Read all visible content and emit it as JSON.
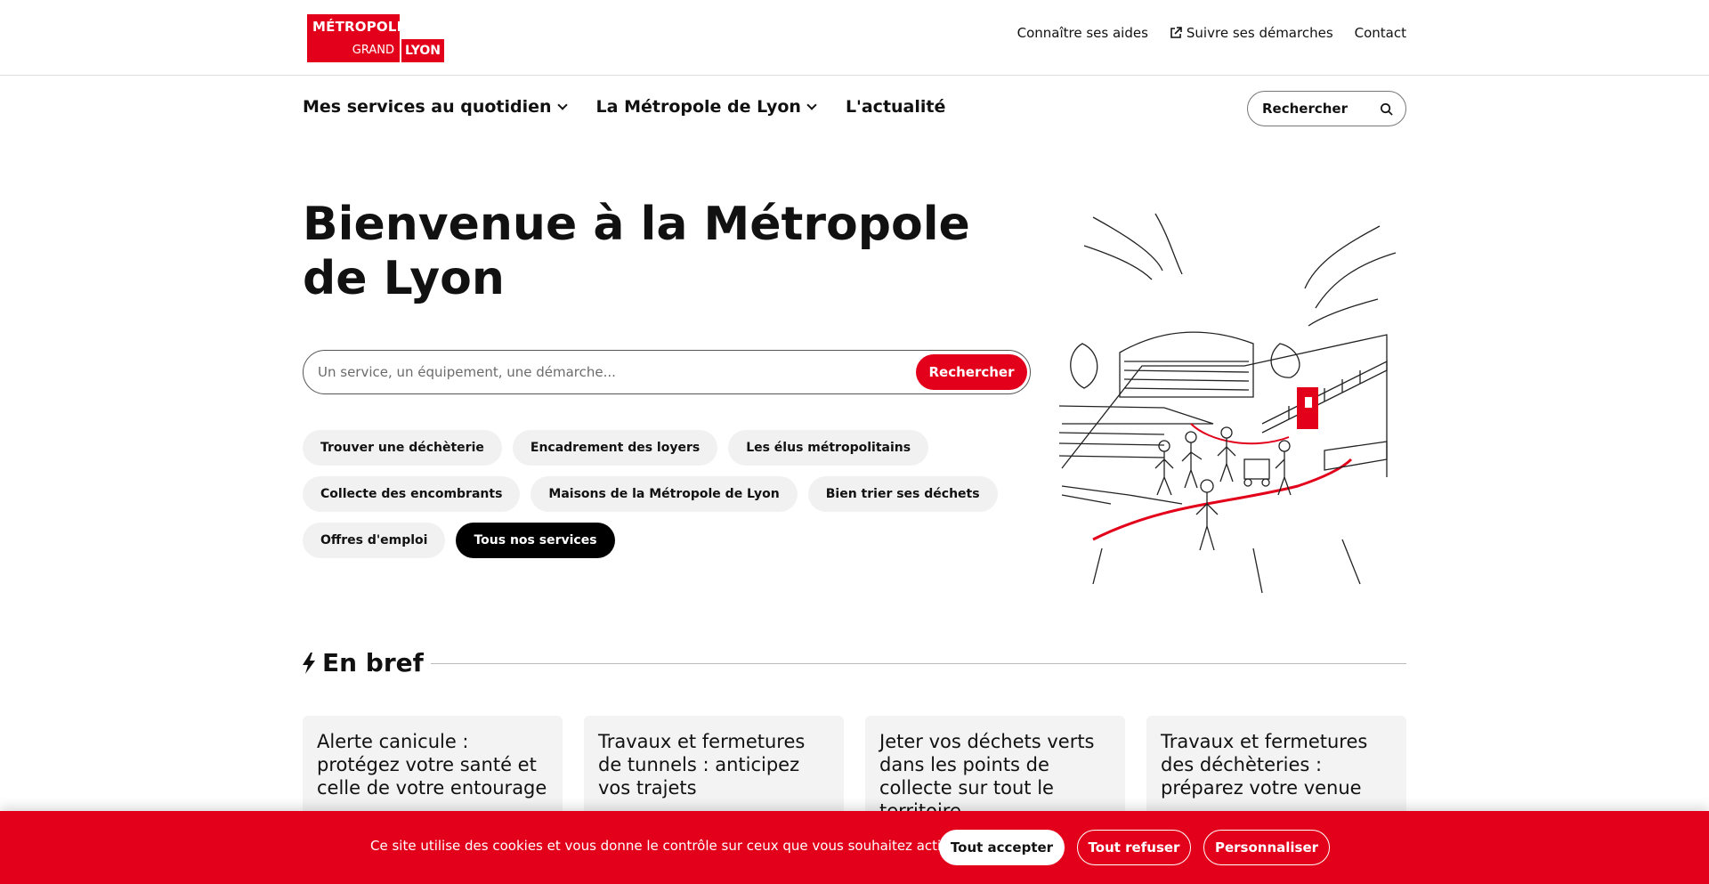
{
  "brand": {
    "line1": "MÉTROPOLE",
    "line2": "GRAND",
    "line3": "LYON",
    "color": "#e2001a"
  },
  "toplinks": [
    "Connaître ses aides",
    "Suivre ses démarches",
    "Contact"
  ],
  "nav": {
    "items": [
      "Mes services au quotidien",
      "La Métropole de Lyon",
      "L'actualité"
    ],
    "search_label": "Rechercher"
  },
  "hero": {
    "title": "Bienvenue à la Métropole de Lyon"
  },
  "search": {
    "placeholder": "Un service, un équipement, une démarche...",
    "button": "Rechercher"
  },
  "quicklinks": [
    "Trouver une déchèterie",
    "Encadrement des loyers",
    "Les élus métropolitains",
    "Collecte des encombrants",
    "Maisons de la Métropole de Lyon",
    "Bien trier ses déchets",
    "Offres d'emploi",
    "Tous nos services"
  ],
  "brief": {
    "title": "En bref",
    "cards": [
      "Alerte canicule : protégez votre santé et celle de votre entourage",
      "Travaux et fermetures de tunnels : anticipez vos trajets",
      "Jeter vos déchets verts dans les points de collecte sur tout le territoire",
      "Travaux et fermetures des déchèteries : préparez votre venue"
    ]
  },
  "cookie": {
    "message": "Ce site utilise des cookies et vous donne le contrôle sur ceux que vous souhaitez activer",
    "accept": "Tout accepter",
    "refuse": "Tout refuser",
    "customize": "Personnaliser"
  }
}
